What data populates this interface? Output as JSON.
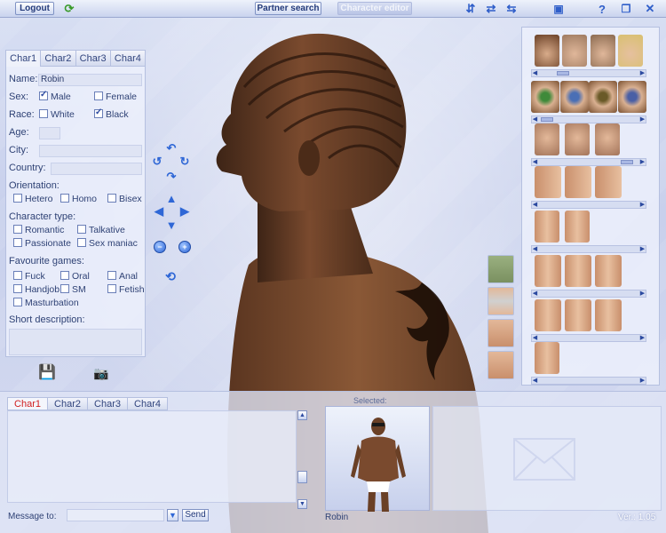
{
  "topbar": {
    "logout_label": "Logout",
    "partner_search_label": "Partner search",
    "character_editor_label": "Character editor",
    "icons": [
      "refresh-icon",
      "rotate-icon-1",
      "rotate-icon-2",
      "rotate-icon-3",
      "window-icon",
      "help-icon",
      "minimize-icon",
      "close-icon"
    ]
  },
  "left_panel": {
    "tabs": [
      "Char1",
      "Char2",
      "Char3",
      "Char4"
    ],
    "active_tab": "Char1",
    "name_label": "Name:",
    "name_value": "Robin",
    "sex_label": "Sex:",
    "sex_options": [
      {
        "label": "Male",
        "checked": true
      },
      {
        "label": "Female",
        "checked": false
      }
    ],
    "race_label": "Race:",
    "race_options": [
      {
        "label": "White",
        "checked": false
      },
      {
        "label": "Black",
        "checked": true
      }
    ],
    "age_label": "Age:",
    "age_value": "",
    "city_label": "City:",
    "city_value": "",
    "country_label": "Country:",
    "country_value": "",
    "orientation_label": "Orientation:",
    "orientation_options": [
      {
        "label": "Hetero",
        "checked": false
      },
      {
        "label": "Homo",
        "checked": false
      },
      {
        "label": "Bisex",
        "checked": false
      }
    ],
    "character_type_label": "Character type:",
    "character_type_options": [
      {
        "label": "Romantic",
        "checked": false
      },
      {
        "label": "Talkative",
        "checked": false
      },
      {
        "label": "Passionate",
        "checked": false
      },
      {
        "label": "Sex maniac",
        "checked": false
      }
    ],
    "favourite_games_label": "Favourite games:",
    "favourite_games_options": [
      {
        "label": "Fuck",
        "checked": false
      },
      {
        "label": "Oral",
        "checked": false
      },
      {
        "label": "Anal",
        "checked": false
      },
      {
        "label": "Handjob",
        "checked": false
      },
      {
        "label": "SM",
        "checked": false
      },
      {
        "label": "Fetish",
        "checked": false
      },
      {
        "label": "Masturbation",
        "checked": false
      }
    ],
    "short_description_label": "Short description:",
    "short_description_value": ""
  },
  "center_controls": {
    "icons": [
      "rotate-up-icon",
      "rotate-left-icon",
      "rotate-right-icon",
      "rotate-down-icon",
      "move-up-icon",
      "move-left-icon",
      "move-right-icon",
      "move-down-icon",
      "zoom-out-icon",
      "zoom-in-icon",
      "camera-reset-icon"
    ]
  },
  "bottom": {
    "chat_tabs": [
      "Char1",
      "Char2",
      "Char3",
      "Char4"
    ],
    "active_chat_tab": "Char1",
    "message_to_label": "Message to:",
    "message_to_value": "",
    "send_label": "Send",
    "selected_label": "Selected:",
    "selected_name": "Robin",
    "version": "Ver.: 1.05"
  },
  "colors": {
    "accent": "#2f67d6",
    "active_tab_text": "#d02020",
    "skin": "#7a4a2e"
  }
}
